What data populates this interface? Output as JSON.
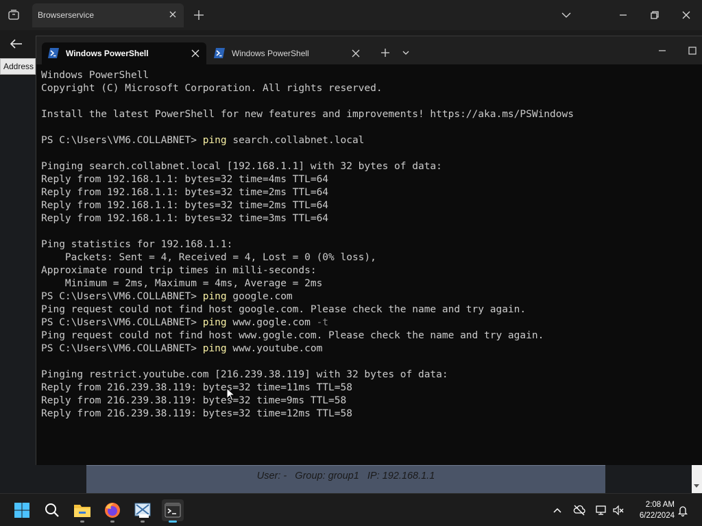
{
  "browser": {
    "tab_title": "Browserservice",
    "address_label": "Address"
  },
  "terminal": {
    "tabs": [
      {
        "label": "Windows PowerShell",
        "active": true
      },
      {
        "label": "Windows PowerShell",
        "active": false
      }
    ],
    "lines": [
      {
        "text": "Windows PowerShell"
      },
      {
        "text": "Copyright (C) Microsoft Corporation. All rights reserved."
      },
      {
        "text": ""
      },
      {
        "text": "Install the latest PowerShell for new features and improvements! https://aka.ms/PSWindows"
      },
      {
        "text": ""
      },
      {
        "prompt": "PS C:\\Users\\VM6.COLLABNET> ",
        "cmd": "ping",
        "arg": " search.collabnet.local"
      },
      {
        "text": ""
      },
      {
        "text": "Pinging search.collabnet.local [192.168.1.1] with 32 bytes of data:"
      },
      {
        "text": "Reply from 192.168.1.1: bytes=32 time=4ms TTL=64"
      },
      {
        "text": "Reply from 192.168.1.1: bytes=32 time=2ms TTL=64"
      },
      {
        "text": "Reply from 192.168.1.1: bytes=32 time=2ms TTL=64"
      },
      {
        "text": "Reply from 192.168.1.1: bytes=32 time=3ms TTL=64"
      },
      {
        "text": ""
      },
      {
        "text": "Ping statistics for 192.168.1.1:"
      },
      {
        "text": "    Packets: Sent = 4, Received = 4, Lost = 0 (0% loss),"
      },
      {
        "text": "Approximate round trip times in milli-seconds:"
      },
      {
        "text": "    Minimum = 2ms, Maximum = 4ms, Average = 2ms"
      },
      {
        "prompt": "PS C:\\Users\\VM6.COLLABNET> ",
        "cmd": "ping",
        "arg": " google.com"
      },
      {
        "text": "Ping request could not find host google.com. Please check the name and try again."
      },
      {
        "prompt": "PS C:\\Users\\VM6.COLLABNET> ",
        "cmd": "ping",
        "arg": " www.gogle.com",
        "flag": " -t"
      },
      {
        "text": "Ping request could not find host www.gogle.com. Please check the name and try again."
      },
      {
        "prompt": "PS C:\\Users\\VM6.COLLABNET> ",
        "cmd": "ping",
        "arg": " www.youtube.com"
      },
      {
        "text": ""
      },
      {
        "text": "Pinging restrict.youtube.com [216.239.38.119] with 32 bytes of data:"
      },
      {
        "text": "Reply from 216.239.38.119: bytes=32 time=11ms TTL=58"
      },
      {
        "text": "Reply from 216.239.38.119: bytes=32 time=9ms TTL=58"
      },
      {
        "text": "Reply from 216.239.38.119: bytes=32 time=12ms TTL=58"
      }
    ]
  },
  "info_bar": {
    "text": "User: -   Group: group1   IP: 192.168.1.1"
  },
  "taskbar": {
    "apps": [
      "start-icon",
      "search-icon",
      "file-explorer-icon",
      "firefox-icon",
      "vlc-icon",
      "terminal-icon"
    ],
    "time": "2:08 AM",
    "date": "6/22/2024"
  },
  "colors": {
    "terminal_bg": "#0c0c0c",
    "command": "#f9f1a5",
    "text": "#cccccc",
    "accent": "#4cc2ff",
    "info_bar": "#4a5467"
  }
}
